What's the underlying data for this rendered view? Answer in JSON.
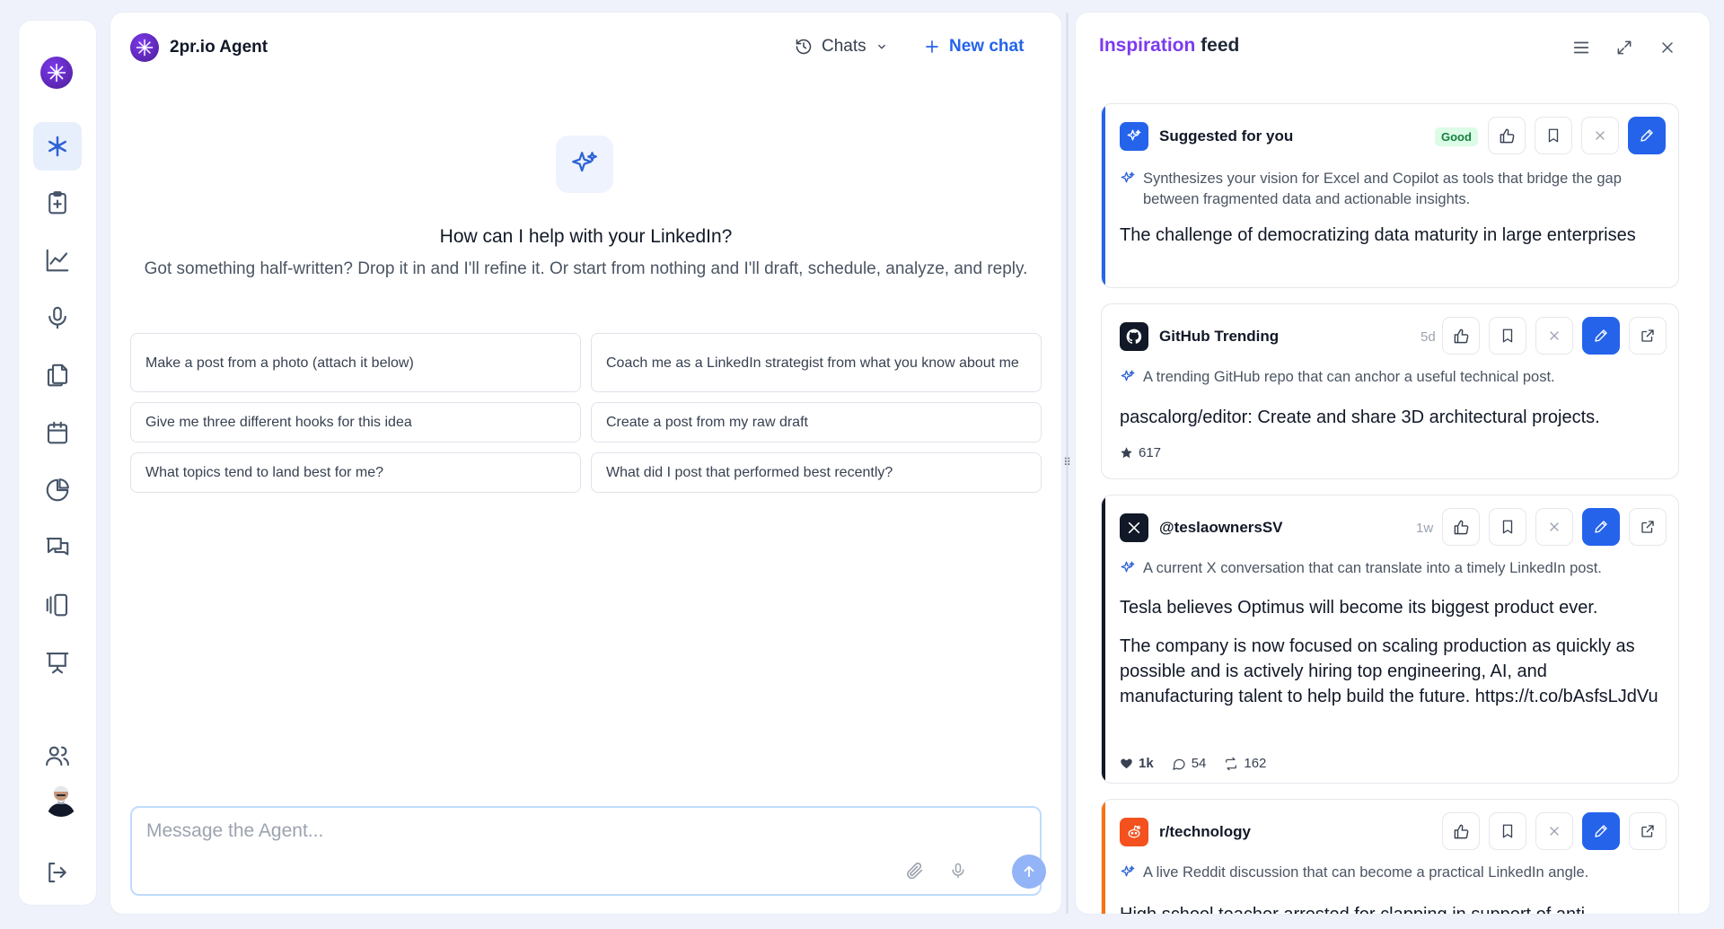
{
  "app": {
    "name": "2pr.io Agent"
  },
  "header": {
    "chats_label": "Chats",
    "new_chat_label": "New chat"
  },
  "welcome": {
    "title": "How can I help with your LinkedIn?",
    "subtitle": "Got something half-written? Drop it in and I'll refine it. Or start from nothing and I'll draft, schedule, analyze, and reply."
  },
  "suggestions": [
    "Make a post from a photo (attach it below)",
    "Coach me as a LinkedIn strategist from what you know about me",
    "Give me three different hooks for this idea",
    "Create a post from my raw draft",
    "What topics tend to land best for me?",
    "What did I post that performed best recently?"
  ],
  "composer": {
    "placeholder": "Message the Agent..."
  },
  "feed": {
    "title_accent": "Inspiration",
    "title_rest": " feed",
    "cards": [
      {
        "source": "Suggested for you",
        "badge": "Good",
        "reason": "Synthesizes your vision for Excel and Copilot as tools that bridge the gap between fragmented data and actionable insights.",
        "headline": "The challenge of democratizing data maturity in large enterprises",
        "accent": "#2563eb"
      },
      {
        "source": "GitHub Trending",
        "age": "5d",
        "reason": "A trending GitHub repo that can anchor a useful technical post.",
        "headline": "pascalorg/editor: Create and share 3D architectural projects.",
        "stars": "617",
        "accent": "#e5e7eb"
      },
      {
        "source": "@teslaownersSV",
        "age": "1w",
        "reason": "A current X conversation that can translate into a timely LinkedIn post.",
        "headline": "Tesla believes Optimus will become its biggest product ever.",
        "body": "The company is now focused on scaling production as quickly as possible and is actively hiring top engineering, AI, and manufacturing talent to help build the future. https://t.co/bAsfsLJdVu",
        "likes": "1k",
        "comments": "54",
        "reposts": "162",
        "accent": "#111827"
      },
      {
        "source": "r/technology",
        "reason": "A live Reddit discussion that can become a practical LinkedIn angle.",
        "headline": "High school teacher arrested for clapping in support of anti-",
        "accent": "#f97316"
      }
    ]
  },
  "colors": {
    "primary": "#2563eb",
    "brand": "#7c3aed",
    "good": "#15803d",
    "reddit": "#f4511e"
  }
}
